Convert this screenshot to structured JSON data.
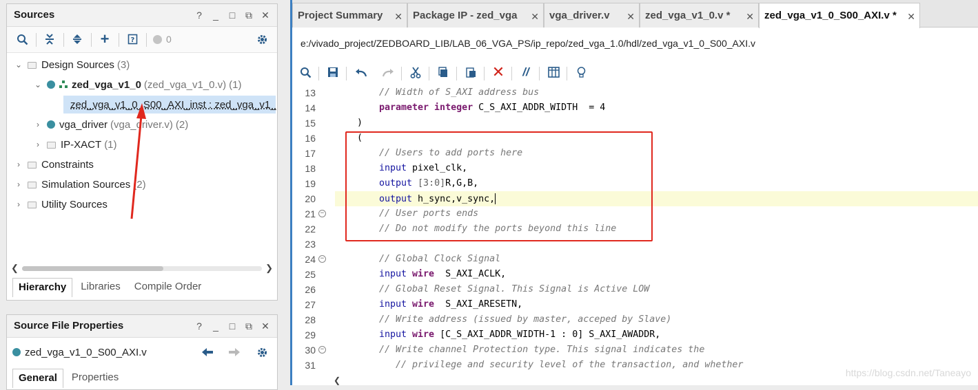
{
  "sources": {
    "title": "Sources",
    "controls": [
      "?",
      "_",
      "□",
      "⧉",
      "✕"
    ],
    "badge": "0",
    "tree": {
      "design_sources": {
        "label": "Design Sources",
        "count": "(3)"
      },
      "top": {
        "label": "zed_vga_v1_0",
        "file": "(zed_vga_v1_0.v)",
        "count": "(1)"
      },
      "inst": {
        "label": "zed_vga_v1_0_S00_AXI_inst : zed_vga_v1_"
      },
      "vga_driver": {
        "label": "vga_driver",
        "file": "(vga_driver.v)",
        "count": "(2)"
      },
      "ipxact": {
        "label": "IP-XACT",
        "count": "(1)"
      },
      "constraints": {
        "label": "Constraints"
      },
      "sim": {
        "label": "Simulation Sources",
        "count": "(2)"
      },
      "utility": {
        "label": "Utility Sources"
      }
    },
    "tabs": [
      "Hierarchy",
      "Libraries",
      "Compile Order"
    ]
  },
  "props": {
    "title": "Source File Properties",
    "controls": [
      "?",
      "_",
      "□",
      "⧉",
      "✕"
    ],
    "file": "zed_vga_v1_0_S00_AXI.v",
    "tabs": [
      "General",
      "Properties"
    ]
  },
  "editor": {
    "tabs": [
      "Project Summary",
      "Package IP - zed_vga",
      "vga_driver.v",
      "zed_vga_v1_0.v *",
      "zed_vga_v1_0_S00_AXI.v *"
    ],
    "path": "e:/vivado_project/ZEDBOARD_LIB/LAB_06_VGA_PS/ip_repo/zed_vga_1.0/hdl/zed_vga_v1_0_S00_AXI.v",
    "line_numbers": [
      "13",
      "14",
      "15",
      "16",
      "17",
      "18",
      "19",
      "20",
      "21",
      "22",
      "23",
      "24",
      "25",
      "26",
      "27",
      "28",
      "29",
      "30",
      "31"
    ],
    "code": {
      "l13": "// Width of S_AXI address bus",
      "l14_kw": "parameter integer",
      "l14_rest": " C_S_AXI_ADDR_WIDTH  = 4",
      "l15": ")",
      "l16": "(",
      "l17": "// Users to add ports here",
      "l18_kw": "input",
      "l18_rest": " pixel_clk,",
      "l19_kw": "output",
      "l19_dg": " [3:0]",
      "l19_rest": "R,G,B,",
      "l20_kw": "output",
      "l20_rest": " h_sync,v_sync,",
      "l21": "// User ports ends",
      "l22": "// Do not modify the ports beyond this line",
      "l24": "// Global Clock Signal",
      "l25_kw": "input",
      "l25_w": " wire",
      "l25_rest": "  S_AXI_ACLK,",
      "l26": "// Global Reset Signal. This Signal is Active LOW",
      "l27_kw": "input",
      "l27_w": " wire",
      "l27_rest": "  S_AXI_ARESETN,",
      "l28": "// Write address (issued by master, acceped by Slave)",
      "l29_kw": "input",
      "l29_w": " wire",
      "l29_rest": " [C_S_AXI_ADDR_WIDTH-1 : 0] S_AXI_AWADDR,",
      "l30": "// Write channel Protection type. This signal indicates the",
      "l31": "   // privilege and security level of the transaction, and whether"
    },
    "watermark": "https://blog.csdn.net/Taneayo"
  },
  "colors": {
    "accent": "#3c7fc1",
    "highlight_box": "#e0281e",
    "selection": "#cfe3f7"
  }
}
